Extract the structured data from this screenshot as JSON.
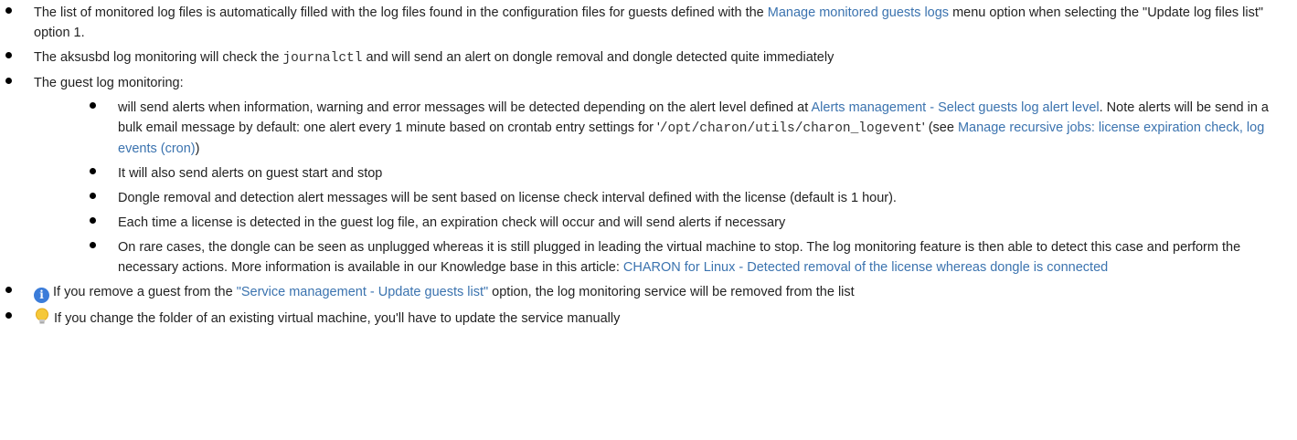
{
  "items": [
    {
      "t1": "The list of monitored log files is automatically filled with the log files found in the configuration files for guests defined with the ",
      "link1": "Manage monitored guests logs",
      "t2": " menu option when selecting the \"Update log files list\" option 1."
    },
    {
      "t1": "The aksusbd log monitoring will check the ",
      "code1": "journalctl",
      "t2": " and will send an alert on dongle removal and dongle detected quite immediately"
    },
    {
      "t1": "The guest log monitoring:",
      "sub": [
        {
          "t1": "will send alerts when information, warning and error messages will be detected depending on the alert level defined at ",
          "link1": "Alerts management - Select guests log alert level",
          "t2": ". Note alerts will be send in a bulk email message by default: one alert every 1 minute based on crontab entry settings for '",
          "code1": "/opt/charon/utils/charon_logevent",
          "t3": "' (see ",
          "link2": "Manage recursive jobs: license expiration check, log events (cron)",
          "t4": ")"
        },
        {
          "t1": "It will also send alerts on guest start and stop"
        },
        {
          "t1": "Dongle removal and detection alert messages will be sent based on license check interval defined with the license (default is 1 hour)."
        },
        {
          "t1": "Each time a license is detected in the guest log file, an expiration check will occur and will send alerts if necessary"
        },
        {
          "t1": "On rare cases, the dongle can be seen as unplugged whereas it is still plugged in leading the virtual machine to stop. The log monitoring feature is then able to detect this case and perform the necessary actions. More information is available in our Knowledge base in this article: ",
          "link1": "CHARON for Linux - Detected removal of the license whereas dongle is connected"
        }
      ]
    },
    {
      "icon": "info-icon",
      "t1": "If you remove a guest from the ",
      "link1": "\"Service management - Update guests list\"",
      "t2": " option, the log monitoring service will be removed from the list"
    },
    {
      "icon": "lightbulb-icon",
      "t1": "If you change the folder of an existing virtual machine, you'll have to update the service manually"
    }
  ],
  "colors": {
    "link": "#3b73af",
    "text": "#222222",
    "info_icon": "#3b7cd9",
    "bulb": "#f5c83a"
  }
}
